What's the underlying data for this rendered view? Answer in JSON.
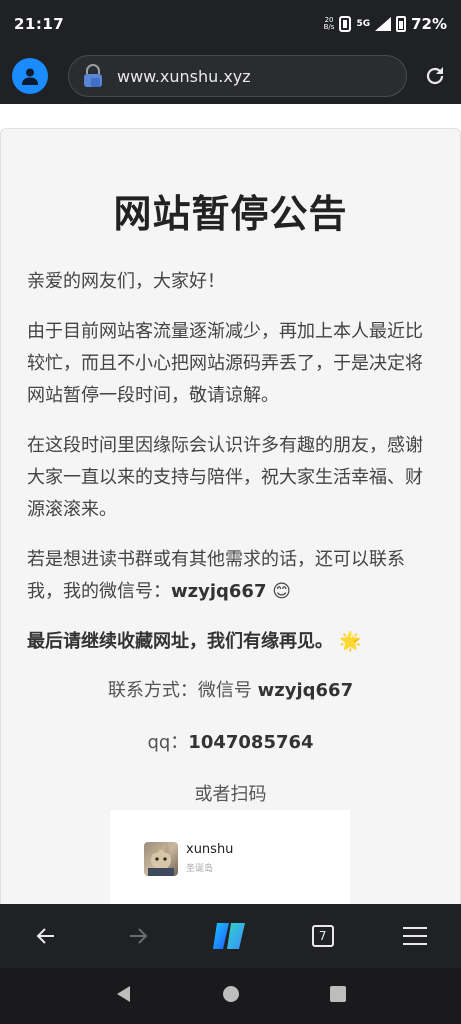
{
  "status": {
    "time": "21:17",
    "data_rate_top": "20",
    "data_rate_bottom": "B/s",
    "network": "5G",
    "battery": "72%"
  },
  "browser": {
    "url": "www.xunshu.xyz",
    "tab_count": "7"
  },
  "page": {
    "title": "网站暂停公告",
    "greeting": "亲爱的网友们，大家好！",
    "para1": "由于目前网站客流量逐渐减少，再加上本人最近比较忙，而且不小心把网站源码弄丢了，于是决定将网站暂停一段时间，敬请谅解。",
    "para2": "在这段时间里因缘际会认识许多有趣的朋友，感谢大家一直以来的支持与陪伴，祝大家生活幸福、财源滚滚来。",
    "para3_prefix": "若是想进读书群或有其他需求的话，还可以联系我，我的微信号：",
    "para3_wechat": "wzyjq667",
    "para3_emoji": "😊",
    "para4": "最后请继续收藏网址，我们有缘再见。",
    "para4_emoji": "🌟",
    "contact_label": "联系方式：微信号 ",
    "contact_wechat": "wzyjq667",
    "qq_label": "qq：",
    "qq_number": "1047085764",
    "scan_text": "或者扫码",
    "qr_name": "xunshu",
    "qr_sub": "圣诞岛"
  }
}
